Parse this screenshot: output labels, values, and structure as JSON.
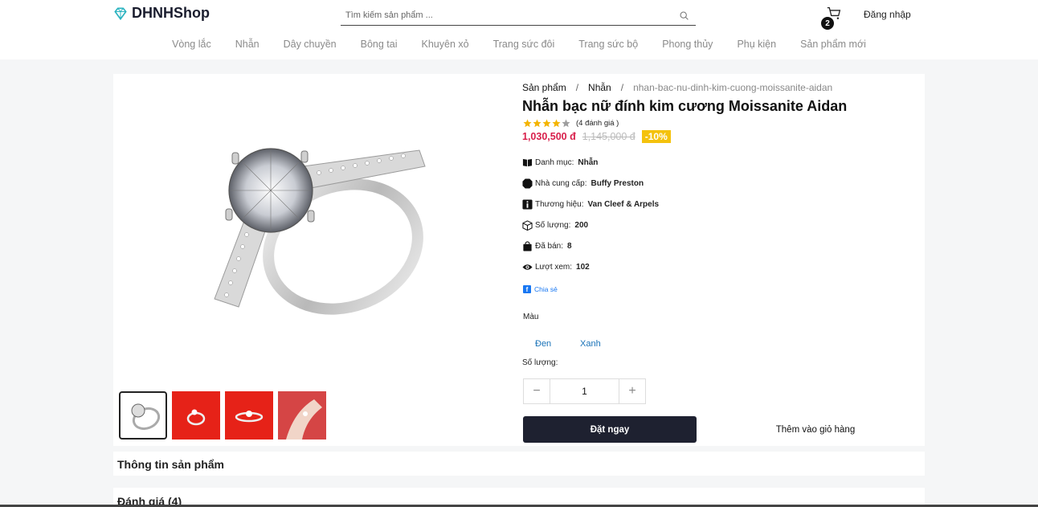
{
  "brand": {
    "name": "DHNHShop"
  },
  "search": {
    "placeholder": "Tìm kiếm sản phẩm ..."
  },
  "cart": {
    "count": "2"
  },
  "auth": {
    "login_label": "Đăng nhập"
  },
  "nav": [
    {
      "label": "Vòng lắc"
    },
    {
      "label": "Nhẫn"
    },
    {
      "label": "Dây chuyền"
    },
    {
      "label": "Bông tai"
    },
    {
      "label": "Khuyên xỏ"
    },
    {
      "label": "Trang sức đôi"
    },
    {
      "label": "Trang sức bộ"
    },
    {
      "label": "Phong thủy"
    },
    {
      "label": "Phụ kiện"
    },
    {
      "label": "Sản phẩm mới"
    }
  ],
  "breadcrumb": {
    "root": "Sản phẩm",
    "category": "Nhẫn",
    "slug": "nhan-bac-nu-dinh-kim-cuong-moissanite-aidan"
  },
  "product": {
    "title": "Nhẫn bạc nữ đính kim cương Moissanite Aidan",
    "rating_stars": 4,
    "rating_count": "(4 đánh giá )",
    "price": "1,030,500 đ",
    "old_price": "1,145,000 đ",
    "discount": "-10%",
    "category_label": "Danh mục:",
    "category_value": "Nhẫn",
    "supplier_label": "Nhà cung cấp:",
    "supplier_value": "Buffy Preston",
    "brand_label": "Thương hiệu:",
    "brand_value": "Van Cleef & Arpels",
    "stock_label": "Số lượng:",
    "stock_value": "200",
    "sold_label": "Đã bán:",
    "sold_value": "8",
    "views_label": "Lượt xem:",
    "views_value": "102",
    "share_label": "Chia sẻ",
    "color_label": "Màu",
    "colors": [
      "Đen",
      "Xanh"
    ],
    "quantity_label": "Số lượng:",
    "quantity_value": "1",
    "buy_label": "Đặt ngay",
    "add_cart_label": "Thêm vào giỏ hàng"
  },
  "sections": {
    "info_title": "Thông tin sản phẩm",
    "reviews_title": "Đánh giá (4)"
  },
  "colors": {
    "price": "#d81f4b",
    "discount_bg": "#f4c20d",
    "primary_btn": "#1e2130",
    "thumb_red": "#e62218"
  }
}
